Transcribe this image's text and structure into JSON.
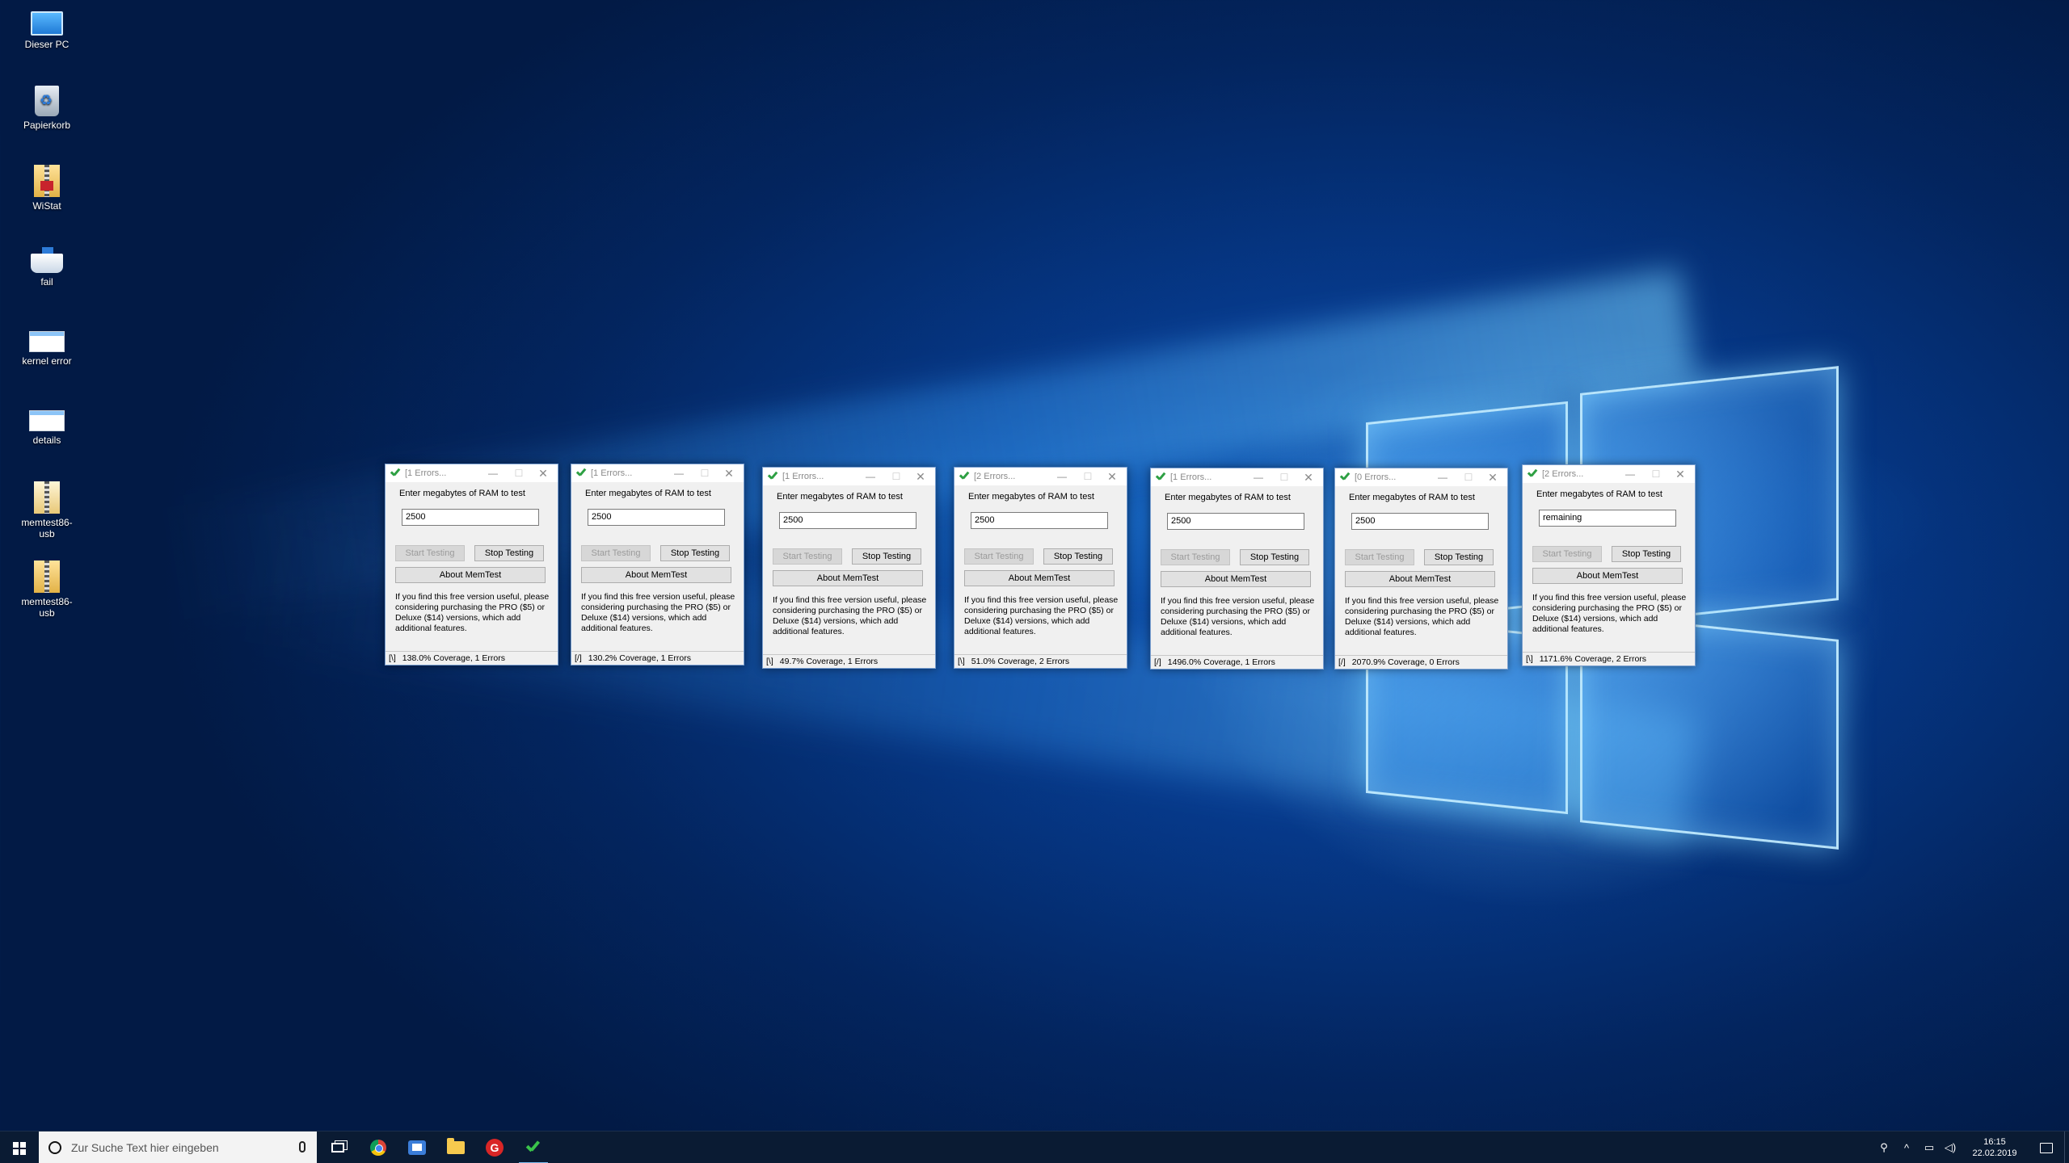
{
  "desktop_icons": [
    {
      "label": "Dieser PC",
      "icon": "computer-icon"
    },
    {
      "label": "Papierkorb",
      "icon": "recycle-bin-icon"
    },
    {
      "label": "WiStat",
      "icon": "zip-folder-icon"
    },
    {
      "label": "fail",
      "icon": "ship-image-icon"
    },
    {
      "label": "kernel error",
      "icon": "screenshot-icon"
    },
    {
      "label": "details",
      "icon": "screenshot-icon"
    },
    {
      "label": "memtest86-usb",
      "icon": "document-icon"
    },
    {
      "label": "memtest86-usb",
      "icon": "zip-folder-icon"
    }
  ],
  "memtest": {
    "prompt": "Enter megabytes of RAM to test",
    "start_label": "Start Testing",
    "stop_label": "Stop Testing",
    "about_label": "About MemTest",
    "info": "If you find this free version useful, please considering purchasing the PRO ($5) or Deluxe ($14) versions, which add additional features.",
    "windows": [
      {
        "title": "[1 Errors...",
        "value": "2500",
        "spinner": "[\\]",
        "status": "138.0% Coverage, 1 Errors"
      },
      {
        "title": "[1 Errors...",
        "value": "2500",
        "spinner": "[/]",
        "status": "130.2% Coverage, 1 Errors"
      },
      {
        "title": "[1 Errors...",
        "value": "2500",
        "spinner": "[\\]",
        "status": "49.7% Coverage, 1 Errors"
      },
      {
        "title": "[2 Errors...",
        "value": "2500",
        "spinner": "[\\]",
        "status": "51.0% Coverage, 2 Errors"
      },
      {
        "title": "[1 Errors...",
        "value": "2500",
        "spinner": "[/]",
        "status": "1496.0% Coverage, 1 Errors"
      },
      {
        "title": "[0 Errors...",
        "value": "2500",
        "spinner": "[/]",
        "status": "2070.9% Coverage, 0 Errors"
      },
      {
        "title": "[2 Errors...",
        "value": "remaining",
        "spinner": "[\\]",
        "status": "1171.6% Coverage, 2 Errors"
      }
    ]
  },
  "taskbar": {
    "search_placeholder": "Zur Suche Text hier eingeben",
    "apps": [
      "task-view-icon",
      "chrome-icon",
      "thunderbird-icon",
      "file-explorer-icon",
      "red-app-icon",
      "memtest-icon"
    ],
    "time": "16:15",
    "date": "22.02.2019"
  }
}
